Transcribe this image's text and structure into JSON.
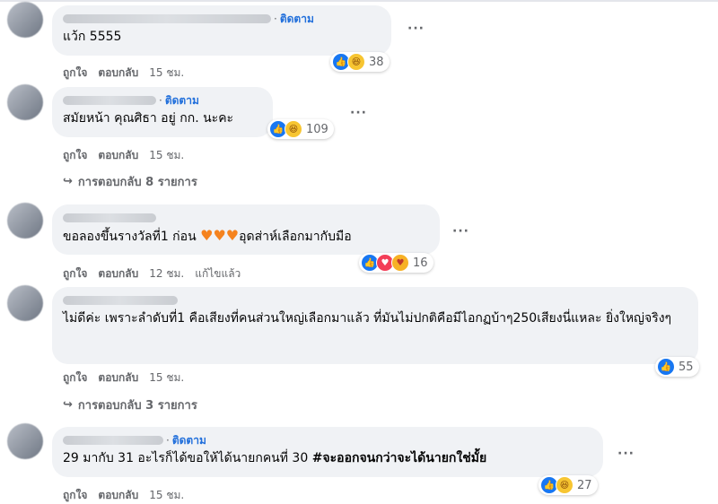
{
  "colors": {
    "bubble_bg": "#f0f2f5",
    "follow_blue": "#216fdb",
    "meta_gray": "#65676b",
    "like_blue": "#1877f2",
    "haha_yellow": "#f7c531"
  },
  "comments": [
    {
      "follow": "ติดตาม",
      "text": "แว้ก 5555",
      "reaction_icons": [
        "like-icon",
        "haha-icon"
      ],
      "reaction_count": "38",
      "like_label": "ถูกใจ",
      "reply_label": "ตอบกลับ",
      "time": "15 ชม."
    },
    {
      "follow": "ติดตาม",
      "text": "สมัยหน้า คุณศิธา อยู่ กก. นะคะ",
      "reaction_icons": [
        "like-icon",
        "haha-icon"
      ],
      "reaction_count": "109",
      "like_label": "ถูกใจ",
      "reply_label": "ตอบกลับ",
      "time": "15 ชม.",
      "replies_label": "การตอบกลับ 8 รายการ"
    },
    {
      "text_before": "ขอลองขึ้นรางวัลที่1 ก่อน ",
      "text_after": "อุดส่าห์เลือกมากับมือ",
      "reaction_icons": [
        "like-icon",
        "love-icon",
        "care-icon"
      ],
      "reaction_count": "16",
      "like_label": "ถูกใจ",
      "reply_label": "ตอบกลับ",
      "time": "12 ชม.",
      "edited": "แก้ไขแล้ว"
    },
    {
      "text": "ไม่ดีค่ะ เพราะลำดับที่1 คือเสียงที่คนส่วนใหญ่เลือกมาแล้ว ที่มันไม่ปกติคือมีไอกฏบ้าๆ250เสียงนี่แหละ ยิ่งใหญ่จริงๆ",
      "reaction_icons": [
        "like-icon"
      ],
      "reaction_count": "55",
      "like_label": "ถูกใจ",
      "reply_label": "ตอบกลับ",
      "time": "15 ชม.",
      "replies_label": "การตอบกลับ 3 รายการ"
    },
    {
      "follow": "ติดตาม",
      "text_plain": "29 มากับ 31 อะไรก็ได้ขอให้ได้นายกคนที่ 30 ",
      "hashtag": "#จะออกจนกว่าจะได้นายกใช่มั้ย",
      "reaction_icons": [
        "like-icon",
        "haha-icon"
      ],
      "reaction_count": "27",
      "like_label": "ถูกใจ",
      "reply_label": "ตอบกลับ",
      "time": "15 ชม."
    }
  ]
}
